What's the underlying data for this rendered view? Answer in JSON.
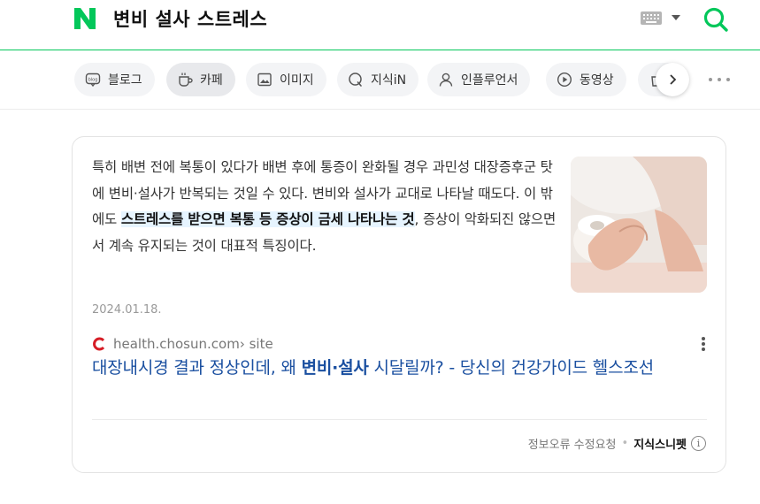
{
  "header": {
    "logo_text": "N",
    "query": "변비 설사 스트레스",
    "colors": {
      "brand": "#03c75a"
    }
  },
  "tabs": [
    {
      "label": "블로그",
      "icon": "blog-icon"
    },
    {
      "label": "카페",
      "icon": "cafe-icon",
      "active": true
    },
    {
      "label": "이미지",
      "icon": "image-icon"
    },
    {
      "label": "지식iN",
      "icon": "kin-icon"
    },
    {
      "label": "인플루언서",
      "icon": "influencer-icon"
    },
    {
      "label": "동영상",
      "icon": "video-icon"
    },
    {
      "label": "",
      "icon": "shopping-icon"
    }
  ],
  "snippet": {
    "text_before": "특히 배변 전에 복통이 있다가 배변 후에 통증이 완화될 경우 과민성 대장증후군 탓에 변비·설사가 반복되는 것일 수 있다. 변비와 설사가 교대로 나타날 때도다. 이 밖에도 ",
    "highlight": "스트레스를 받으면 복통 등 증상이 금세 나타나는 것",
    "text_after": ", 증상이 악화되진 않으면서 계속 유지되는 것이 대표적 특징이다.",
    "date": "2024.01.18."
  },
  "source": {
    "domain": "health.chosun.com",
    "path": " › site",
    "title_before": "대장내시경 결과 정상인데, 왜 ",
    "title_bold": "변비·설사",
    "title_after": " 시달릴까? - 당신의 건강가이드 헬스조선"
  },
  "footer": {
    "report": "정보오류 수정요청",
    "separator": "•",
    "brand": "지식스니펫",
    "info_glyph": "i"
  }
}
